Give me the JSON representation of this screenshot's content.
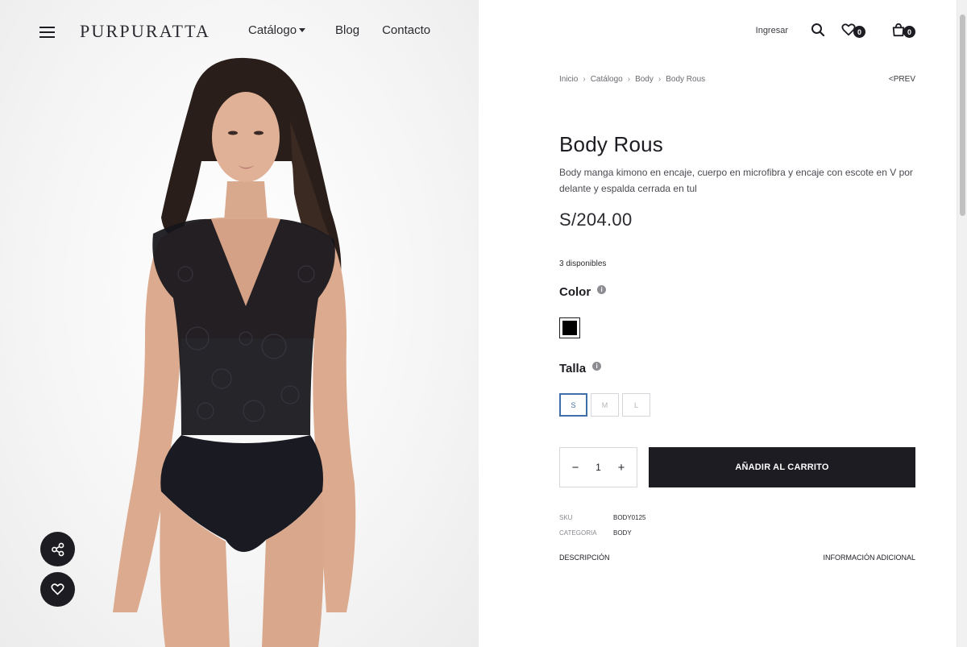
{
  "header": {
    "logo": "PURPURATTA",
    "nav": [
      {
        "label": "Catálogo"
      },
      {
        "label": "Blog"
      },
      {
        "label": "Contacto"
      }
    ],
    "login_label": "Ingresar",
    "wishlist_count": "0",
    "cart_count": "0"
  },
  "breadcrumb": [
    "Inicio",
    "Catálogo",
    "Body",
    "Body Rous"
  ],
  "prev_label": "<PREV",
  "product": {
    "title": "Body Rous",
    "description": "Body manga kimono en encaje, cuerpo en microfibra y encaje con escote en V por delante y espalda cerrada en tul",
    "price": "S/204.00",
    "stock": "3 disponibles",
    "color_label": "Color",
    "selected_color": "#000000",
    "size_label": "Talla",
    "sizes": [
      "S",
      "M",
      "L"
    ],
    "selected_size": "S",
    "quantity": "1",
    "add_to_cart": "AÑADIR AL CARRITO",
    "sku_label": "SKU",
    "sku": "BODY0125",
    "category_label": "CATEGORIA",
    "category": "BODY"
  },
  "tabs": [
    "DESCRIPCIÓN",
    "INFORMACIÓN ADICIONAL"
  ],
  "icons": {
    "menu": "hamburger-icon",
    "search": "search-icon",
    "wishlist": "heart-icon",
    "cart": "bag-icon",
    "share": "share-icon",
    "favorite": "heart-icon",
    "info": "info-icon"
  }
}
